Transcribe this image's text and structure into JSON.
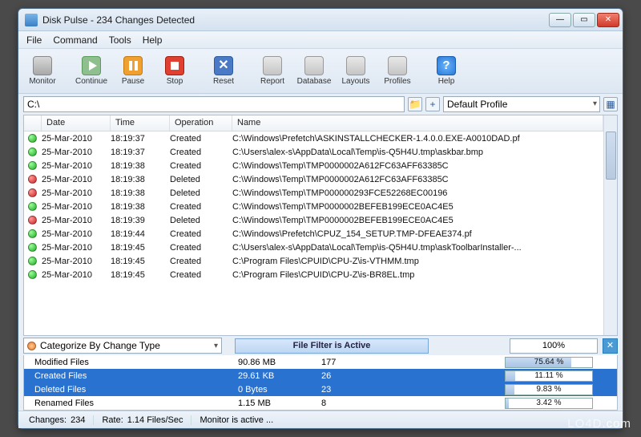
{
  "title": "Disk Pulse - 234 Changes Detected",
  "menu": [
    "File",
    "Command",
    "Tools",
    "Help"
  ],
  "toolbar": [
    {
      "id": "monitor",
      "label": "Monitor"
    },
    {
      "id": "continue",
      "label": "Continue"
    },
    {
      "id": "pause",
      "label": "Pause"
    },
    {
      "id": "stop",
      "label": "Stop"
    },
    {
      "id": "reset",
      "label": "Reset"
    },
    {
      "id": "report",
      "label": "Report"
    },
    {
      "id": "database",
      "label": "Database"
    },
    {
      "id": "layouts",
      "label": "Layouts"
    },
    {
      "id": "profiles",
      "label": "Profiles"
    },
    {
      "id": "help",
      "label": "Help"
    }
  ],
  "path": "C:\\",
  "profile": "Default Profile",
  "columns": {
    "date": "Date",
    "time": "Time",
    "op": "Operation",
    "name": "Name"
  },
  "rows": [
    {
      "c": "green",
      "date": "25-Mar-2010",
      "time": "18:19:37",
      "op": "Created",
      "name": "C:\\Windows\\Prefetch\\ASKINSTALLCHECKER-1.4.0.0.EXE-A0010DAD.pf"
    },
    {
      "c": "green",
      "date": "25-Mar-2010",
      "time": "18:19:37",
      "op": "Created",
      "name": "C:\\Users\\alex-s\\AppData\\Local\\Temp\\is-Q5H4U.tmp\\askbar.bmp"
    },
    {
      "c": "green",
      "date": "25-Mar-2010",
      "time": "18:19:38",
      "op": "Created",
      "name": "C:\\Windows\\Temp\\TMP0000002A612FC63AFF63385C"
    },
    {
      "c": "red",
      "date": "25-Mar-2010",
      "time": "18:19:38",
      "op": "Deleted",
      "name": "C:\\Windows\\Temp\\TMP0000002A612FC63AFF63385C"
    },
    {
      "c": "red",
      "date": "25-Mar-2010",
      "time": "18:19:38",
      "op": "Deleted",
      "name": "C:\\Windows\\Temp\\TMP000000293FCE52268EC00196"
    },
    {
      "c": "green",
      "date": "25-Mar-2010",
      "time": "18:19:38",
      "op": "Created",
      "name": "C:\\Windows\\Temp\\TMP0000002BEFEB199ECE0AC4E5"
    },
    {
      "c": "red",
      "date": "25-Mar-2010",
      "time": "18:19:39",
      "op": "Deleted",
      "name": "C:\\Windows\\Temp\\TMP0000002BEFEB199ECE0AC4E5"
    },
    {
      "c": "green",
      "date": "25-Mar-2010",
      "time": "18:19:44",
      "op": "Created",
      "name": "C:\\Windows\\Prefetch\\CPUZ_154_SETUP.TMP-DFEAE374.pf"
    },
    {
      "c": "green",
      "date": "25-Mar-2010",
      "time": "18:19:45",
      "op": "Created",
      "name": "C:\\Users\\alex-s\\AppData\\Local\\Temp\\is-Q5H4U.tmp\\askToolbarInstaller-..."
    },
    {
      "c": "green",
      "date": "25-Mar-2010",
      "time": "18:19:45",
      "op": "Created",
      "name": "C:\\Program Files\\CPUID\\CPU-Z\\is-VTHMM.tmp"
    },
    {
      "c": "green",
      "date": "25-Mar-2010",
      "time": "18:19:45",
      "op": "Created",
      "name": "C:\\Program Files\\CPUID\\CPU-Z\\is-BR8EL.tmp"
    }
  ],
  "categorize_label": "Categorize By Change Type",
  "filter_label": "File Filter is Active",
  "pct_label": "100%",
  "summary": [
    {
      "c": "yellow",
      "name": "Modified Files",
      "size": "90.86 MB",
      "count": "177",
      "pct": "75.64 %",
      "sel": false,
      "w": 76
    },
    {
      "c": "green",
      "name": "Created Files",
      "size": "29.61 KB",
      "count": "26",
      "pct": "11.11 %",
      "sel": true,
      "w": 11
    },
    {
      "c": "red",
      "name": "Deleted Files",
      "size": "0 Bytes",
      "count": "23",
      "pct": "9.83 %",
      "sel": true,
      "w": 10
    },
    {
      "c": "orange",
      "name": "Renamed Files",
      "size": "1.15 MB",
      "count": "8",
      "pct": "3.42 %",
      "sel": false,
      "w": 4
    }
  ],
  "status": {
    "changes_label": "Changes:",
    "changes": "234",
    "rate_label": "Rate:",
    "rate": "1.14 Files/Sec",
    "msg": "Monitor is active ..."
  },
  "watermark": "LO4D.com"
}
